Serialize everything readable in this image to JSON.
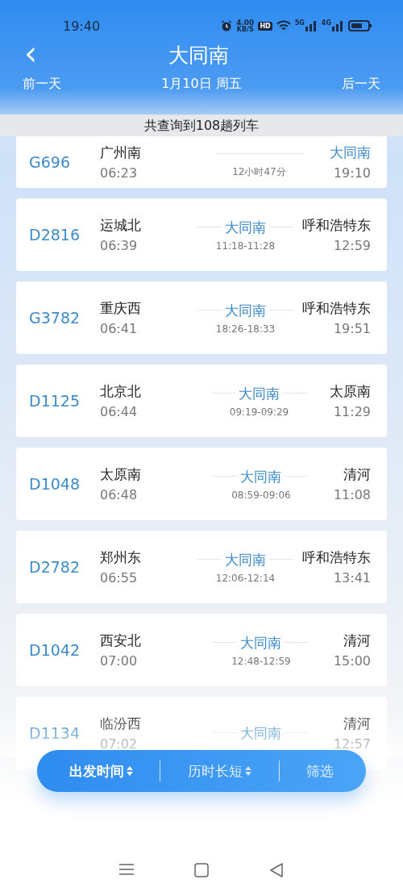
{
  "status_bar": {
    "time": "19:40",
    "net_speed": "4.00",
    "net_unit": "KB/S",
    "hd": "HD",
    "sim1": "5G",
    "sim2": "4G"
  },
  "header": {
    "back": "‹",
    "title": "大同南",
    "prev_day": "前一天",
    "date": "1月10日 周五",
    "next_day": "后一天"
  },
  "result_banner": "共查询到108趟列车",
  "trains": [
    {
      "kind": "direct",
      "number": "G696",
      "from": "广州南",
      "depart": "06:23",
      "duration": "12小时47分",
      "to": "大同南",
      "arrive": "19:10",
      "to_highlight": true
    },
    {
      "kind": "via",
      "number": "D2816",
      "from": "运城北",
      "depart": "06:39",
      "via": "大同南",
      "stop_time": "11:18-11:28",
      "to": "呼和浩特东",
      "arrive": "12:59",
      "to_highlight": false
    },
    {
      "kind": "via",
      "number": "G3782",
      "from": "重庆西",
      "depart": "06:41",
      "via": "大同南",
      "stop_time": "18:26-18:33",
      "to": "呼和浩特东",
      "arrive": "19:51",
      "to_highlight": false
    },
    {
      "kind": "via",
      "number": "D1125",
      "from": "北京北",
      "depart": "06:44",
      "via": "大同南",
      "stop_time": "09:19-09:29",
      "to": "太原南",
      "arrive": "11:29",
      "to_highlight": false
    },
    {
      "kind": "via",
      "number": "D1048",
      "from": "太原南",
      "depart": "06:48",
      "via": "大同南",
      "stop_time": "08:59-09:06",
      "to": "清河",
      "arrive": "11:08",
      "to_highlight": false
    },
    {
      "kind": "via",
      "number": "D2782",
      "from": "郑州东",
      "depart": "06:55",
      "via": "大同南",
      "stop_time": "12:06-12:14",
      "to": "呼和浩特东",
      "arrive": "13:41",
      "to_highlight": false
    },
    {
      "kind": "via",
      "number": "D1042",
      "from": "西安北",
      "depart": "07:00",
      "via": "大同南",
      "stop_time": "12:48-12:59",
      "to": "清河",
      "arrive": "15:00",
      "to_highlight": false
    },
    {
      "kind": "via",
      "number": "D1134",
      "from": "临汾西",
      "depart": "07:02",
      "via": "大同南",
      "to": "清河",
      "arrive": "12:57",
      "to_highlight": false
    }
  ],
  "sort_bar": [
    {
      "kind": "sort",
      "label": "出发时间",
      "selected": true
    },
    {
      "kind": "sort",
      "label": "历时长短",
      "selected": false
    },
    {
      "kind": "filter",
      "label": "筛选",
      "selected": false
    }
  ]
}
